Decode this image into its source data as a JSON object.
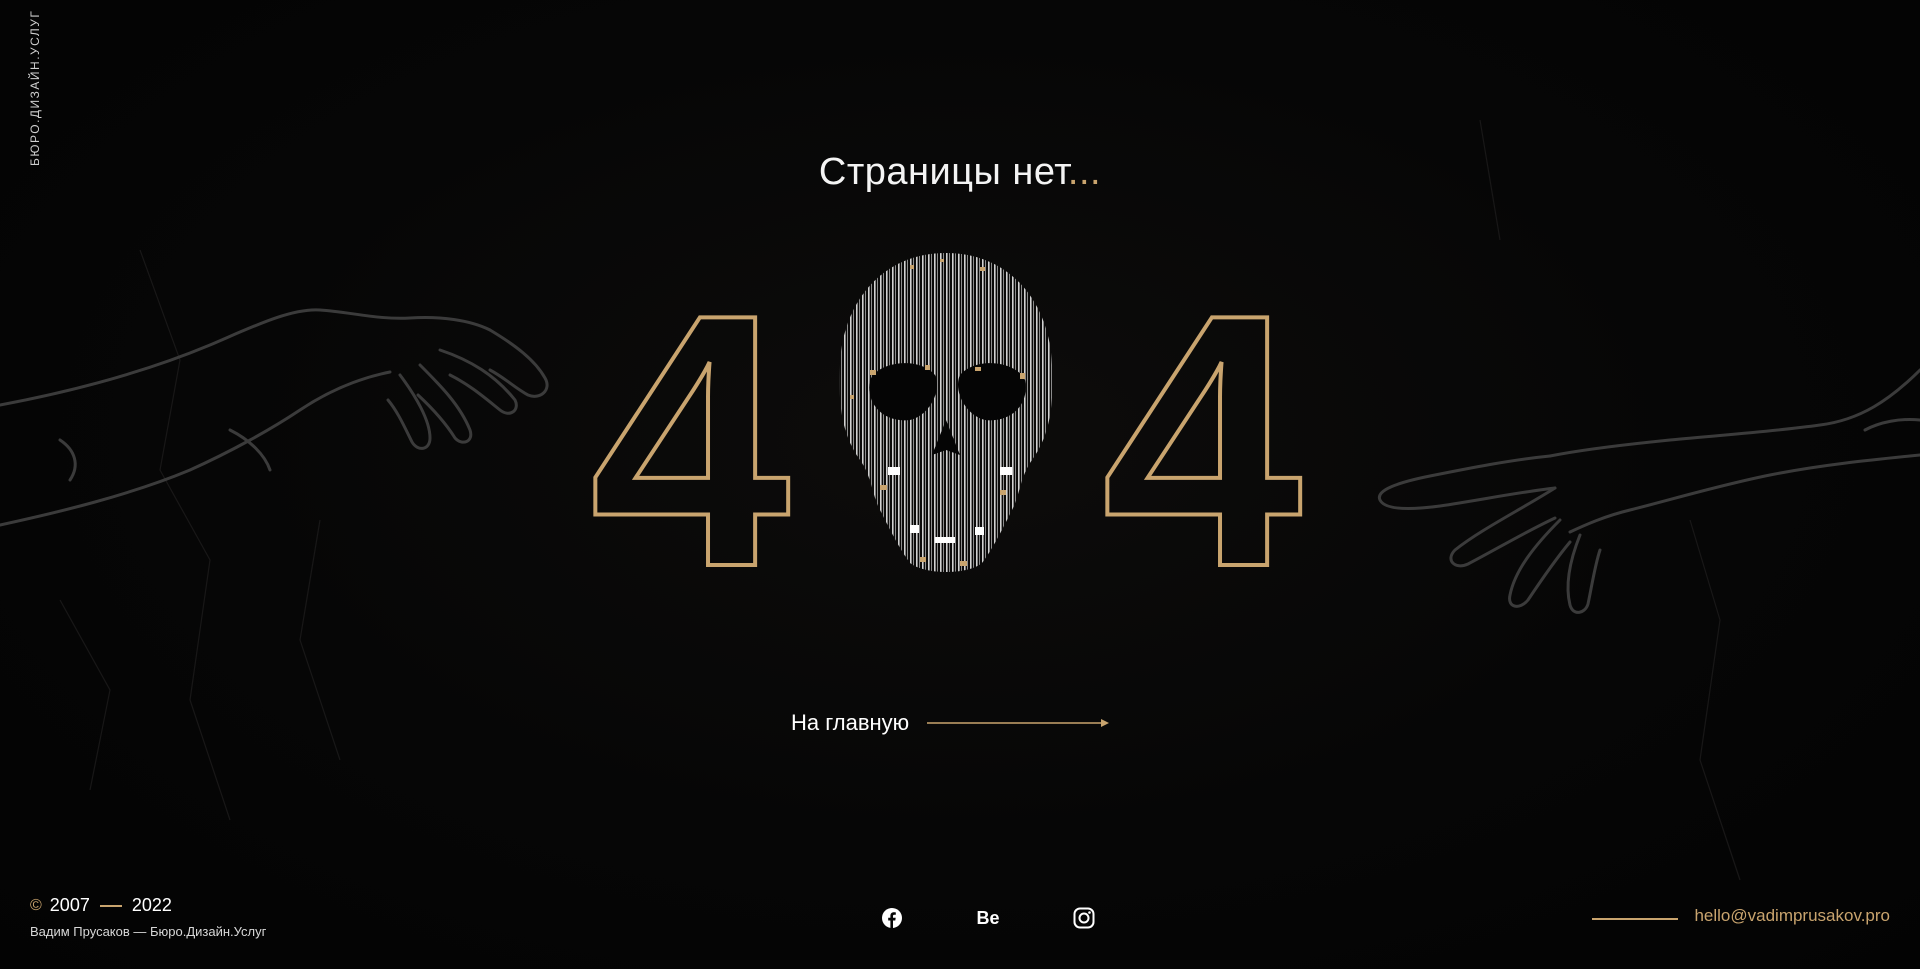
{
  "side_caption": "БЮРО.ДИЗАЙН.УСЛУГ",
  "headline": {
    "text": "Страницы нет",
    "dots": "..."
  },
  "error_code": {
    "digit_left": "4",
    "digit_right": "4"
  },
  "home_link": {
    "label": "На главную"
  },
  "footer": {
    "copyright_start": "2007",
    "copyright_end": "2022",
    "copyright_symbol": "©",
    "author": "Вадим Прусаков — Бюро.Дизайн.Услуг",
    "socials": [
      {
        "name": "facebook-icon"
      },
      {
        "name": "behance-icon",
        "text": "Be"
      },
      {
        "name": "instagram-icon"
      }
    ],
    "email": "hello@vadimprusakov.pro"
  },
  "colors": {
    "accent": "#c9a46e",
    "background": "#050505",
    "text": "#ffffff"
  }
}
